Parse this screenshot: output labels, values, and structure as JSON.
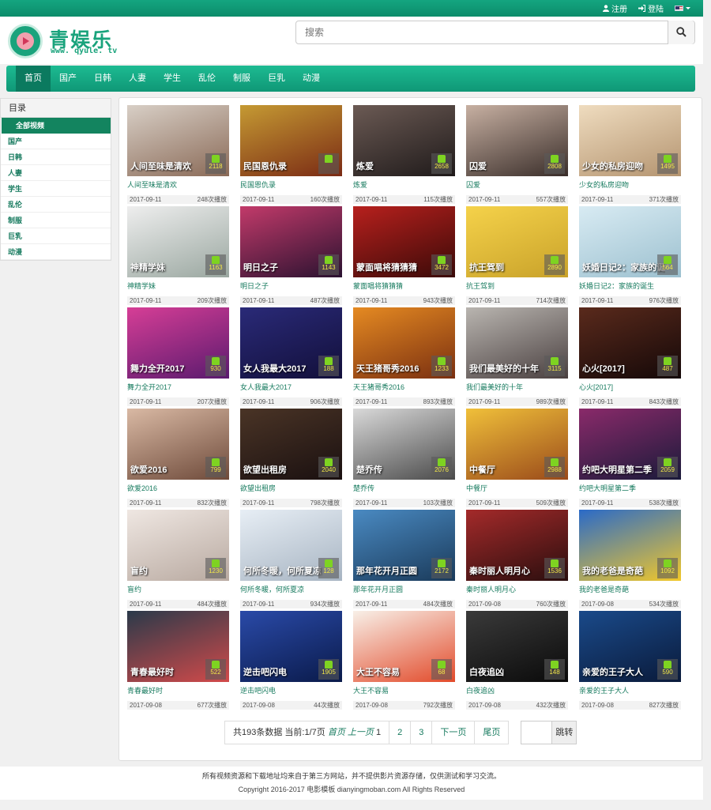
{
  "topbar": {
    "register": "注册",
    "login": "登陆",
    "flag": "us-flag-icon"
  },
  "brand": {
    "name": "青娱乐",
    "url": "www. qyule. tv",
    "color": "#1aa37c"
  },
  "search": {
    "placeholder": "搜索",
    "value": ""
  },
  "nav": [
    "首页",
    "国产",
    "日韩",
    "人妻",
    "学生",
    "乱伦",
    "制服",
    "巨乳",
    "动漫"
  ],
  "sidebar": {
    "title": "目录",
    "items": [
      "全部视频",
      "国产",
      "日韩",
      "人妻",
      "学生",
      "乱伦",
      "制服",
      "巨乳",
      "动漫"
    ]
  },
  "videos": [
    {
      "title": "人间至味是清欢",
      "date": "2017-09-11",
      "plays": "248次播放",
      "likes": "2118",
      "c1": "#d8cfc6",
      "c2": "#8a6a57"
    },
    {
      "title": "民国恩仇录",
      "date": "2017-09-11",
      "plays": "160次播放",
      "likes": "",
      "c1": "#c59a33",
      "c2": "#7a2a14"
    },
    {
      "title": "炼爱",
      "date": "2017-09-11",
      "plays": "115次播放",
      "likes": "2658",
      "c1": "#6b5a54",
      "c2": "#1f1a1a"
    },
    {
      "title": "囚爱",
      "date": "2017-09-11",
      "plays": "557次播放",
      "likes": "2808",
      "c1": "#c7b0a2",
      "c2": "#3a2e2a"
    },
    {
      "title": "少女的私房迎吻",
      "date": "2017-09-11",
      "plays": "371次播放",
      "likes": "1495",
      "c1": "#efdcbf",
      "c2": "#b49470"
    },
    {
      "title": "神精学妹",
      "date": "2017-09-11",
      "plays": "209次播放",
      "likes": "1163",
      "c1": "#eeeeee",
      "c2": "#9aa7a0"
    },
    {
      "title": "明日之子",
      "date": "2017-09-11",
      "plays": "487次播放",
      "likes": "1143",
      "c1": "#c23a6a",
      "c2": "#2a1230"
    },
    {
      "title": "蒙面唱将猜猜猜",
      "date": "2017-09-11",
      "plays": "943次播放",
      "likes": "3472",
      "c1": "#b7201d",
      "c2": "#3a0a08"
    },
    {
      "title": "抗王驾到",
      "date": "2017-09-11",
      "plays": "714次播放",
      "likes": "2890",
      "c1": "#f5d24a",
      "c2": "#c9a22a"
    },
    {
      "title": "妖婚日记2：家族的诞生",
      "date": "2017-09-11",
      "plays": "976次播放",
      "likes": "564",
      "c1": "#d8ebf3",
      "c2": "#9cc0cf"
    },
    {
      "title": "舞力全开2017",
      "date": "2017-09-11",
      "plays": "207次播放",
      "likes": "930",
      "c1": "#d63e96",
      "c2": "#5a1a6e"
    },
    {
      "title": "女人我最大2017",
      "date": "2017-09-11",
      "plays": "906次播放",
      "likes": "188",
      "c1": "#2a2a78",
      "c2": "#120f3a"
    },
    {
      "title": "天王猪哥秀2016",
      "date": "2017-09-11",
      "plays": "893次播放",
      "likes": "1233",
      "c1": "#e58a22",
      "c2": "#7a2f10"
    },
    {
      "title": "我们最美好的十年",
      "date": "2017-09-11",
      "plays": "989次播放",
      "likes": "3115",
      "c1": "#b9b5b0",
      "c2": "#4a4040"
    },
    {
      "title": "心火[2017]",
      "date": "2017-09-11",
      "plays": "843次播放",
      "likes": "487",
      "c1": "#5a2a1c",
      "c2": "#140808"
    },
    {
      "title": "欲爱2016",
      "date": "2017-09-11",
      "plays": "832次播放",
      "likes": "799",
      "c1": "#d9b9a4",
      "c2": "#6e4a3a"
    },
    {
      "title": "欲望出租房",
      "date": "2017-09-11",
      "plays": "798次播放",
      "likes": "2040",
      "c1": "#4a3426",
      "c2": "#1a1010"
    },
    {
      "title": "楚乔传",
      "date": "2017-09-11",
      "plays": "103次播放",
      "likes": "2076",
      "c1": "#d9d9d9",
      "c2": "#4a4a4a"
    },
    {
      "title": "中餐厅",
      "date": "2017-09-11",
      "plays": "509次播放",
      "likes": "2988",
      "c1": "#f0c03a",
      "c2": "#9a4a1a"
    },
    {
      "title": "约吧大明星第二季",
      "date": "2017-09-11",
      "plays": "538次播放",
      "likes": "2059",
      "c1": "#8a2a6a",
      "c2": "#1a1a3a"
    },
    {
      "title": "盲约",
      "date": "2017-09-11",
      "plays": "484次播放",
      "likes": "1230",
      "c1": "#efe7e2",
      "c2": "#b8a9a0"
    },
    {
      "title": "何所冬暖，何所夏凉",
      "date": "2017-09-11",
      "plays": "934次播放",
      "likes": "128",
      "c1": "#e7eef5",
      "c2": "#a7b4c2"
    },
    {
      "title": "那年花开月正圆",
      "date": "2017-09-11",
      "plays": "484次播放",
      "likes": "2172",
      "c1": "#4a8ac2",
      "c2": "#1a3a5a"
    },
    {
      "title": "秦时丽人明月心",
      "date": "2017-09-08",
      "plays": "760次播放",
      "likes": "1536",
      "c1": "#a42a2a",
      "c2": "#2a0e0e"
    },
    {
      "title": "我的老爸是奇葩",
      "date": "2017-09-08",
      "plays": "534次播放",
      "likes": "1092",
      "c1": "#2a6ac8",
      "c2": "#f2c82a"
    },
    {
      "title": "青春最好时",
      "date": "2017-09-08",
      "plays": "677次播放",
      "likes": "522",
      "c1": "#2a3a4a",
      "c2": "#d24a4a"
    },
    {
      "title": "逆击吧闪电",
      "date": "2017-09-08",
      "plays": "44次播放",
      "likes": "1905",
      "c1": "#2a4aa8",
      "c2": "#0a1a4a"
    },
    {
      "title": "大王不容易",
      "date": "2017-09-08",
      "plays": "792次播放",
      "likes": "68",
      "c1": "#f8f0e8",
      "c2": "#e24a2a"
    },
    {
      "title": "白夜追凶",
      "date": "2017-09-08",
      "plays": "432次播放",
      "likes": "148",
      "c1": "#3a3a3a",
      "c2": "#0a0a0a"
    },
    {
      "title": "亲爱的王子大人",
      "date": "2017-09-08",
      "plays": "827次播放",
      "likes": "590",
      "c1": "#1a4a8a",
      "c2": "#0a1a3a"
    }
  ],
  "pager": {
    "info": "共193条数据 当前:1/7页",
    "first": "首页",
    "prev": "上一页",
    "current": "1",
    "pages": [
      "2",
      "3"
    ],
    "next": "下一页",
    "last": "尾页",
    "go": "跳转"
  },
  "footer": {
    "line1": "所有视频资源和下载地址均来自于第三方网站，并不提供影片资源存储，仅供测试和学习交流。",
    "line2": "Copyright 2016-2017 电影模板 dianyingmoban.com All Rights Reserved"
  }
}
